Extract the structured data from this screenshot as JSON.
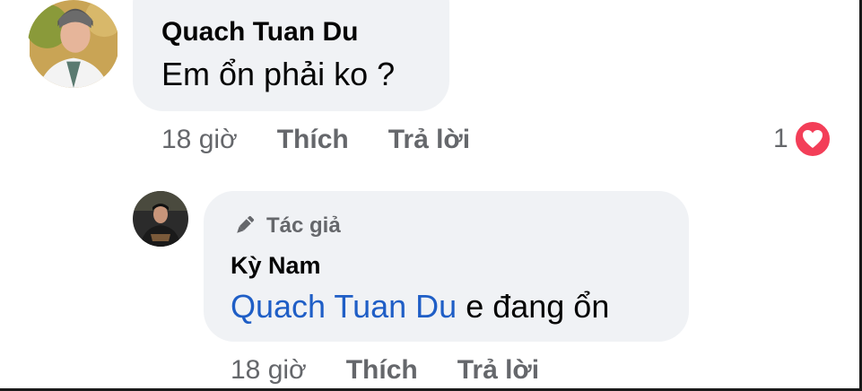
{
  "comments": [
    {
      "author": "Quach Tuan Du",
      "text": "Em ổn phải ko ?",
      "time": "18 giờ",
      "like_label": "Thích",
      "reply_label": "Trả lời",
      "reaction_count": "1",
      "reaction_icon": "heart-love-icon",
      "reaction_color": "#f33e58"
    },
    {
      "badge_label": "Tác giả",
      "badge_icon": "pen-icon",
      "author": "Kỳ Nam",
      "mention": "Quach Tuan Du",
      "text": "e đang ổn",
      "time": "18 giờ",
      "like_label": "Thích",
      "reply_label": "Trả lời"
    }
  ],
  "colors": {
    "bubble_bg": "#f0f2f5",
    "mention": "#1f5ec6",
    "secondary_text": "#65676b"
  }
}
